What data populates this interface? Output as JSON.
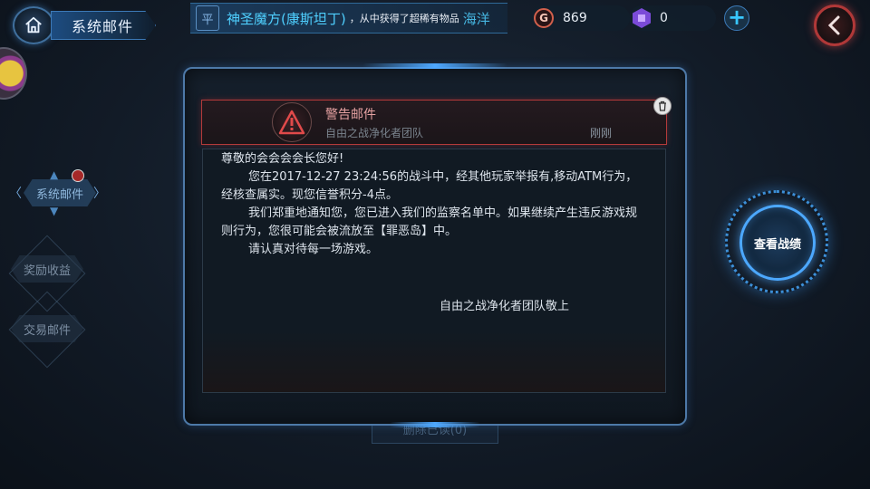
{
  "header": {
    "title": "系统邮件",
    "ticker": {
      "badge": "平",
      "item": "神圣魔方(康斯坦丁)",
      "text": "，从中获得了超稀有物品",
      "tail": "海洋"
    },
    "gold": {
      "icon_letter": "G",
      "amount": "869"
    },
    "gems": {
      "amount": "0"
    },
    "add_label": "+"
  },
  "nav": {
    "items": [
      {
        "label": "系统邮件",
        "active": true
      },
      {
        "label": "奖励收益"
      },
      {
        "label": "交易邮件"
      }
    ]
  },
  "mail": {
    "title": "警告邮件",
    "sender": "自由之战净化者团队",
    "time": "刚刚",
    "body": {
      "greeting": "尊敬的会会会会长您好!",
      "paragraphs": [
        "您在2017-12-27  23:24:56的战斗中，经其他玩家举报有,移动ATM行为，经核查属实。现您信誉积分-4点。",
        "我们郑重地通知您，您已进入我们的监察名单中。如果继续产生违反游戏规则行为，您很可能会被流放至【罪恶岛】中。",
        "请认真对待每一场游戏。"
      ],
      "signature": "自由之战净化者团队敬上"
    }
  },
  "under_button": "删除已读(0)",
  "stats_button": "查看战绩",
  "colors": {
    "accent_blue": "#4ca8ff",
    "warning_red": "#b33a3a",
    "ticker_cyan": "#4fd0ff"
  },
  "icons": [
    "home-icon",
    "back-chevron-icon",
    "gold-coin-icon",
    "gem-icon",
    "warning-triangle-icon",
    "trash-icon"
  ]
}
